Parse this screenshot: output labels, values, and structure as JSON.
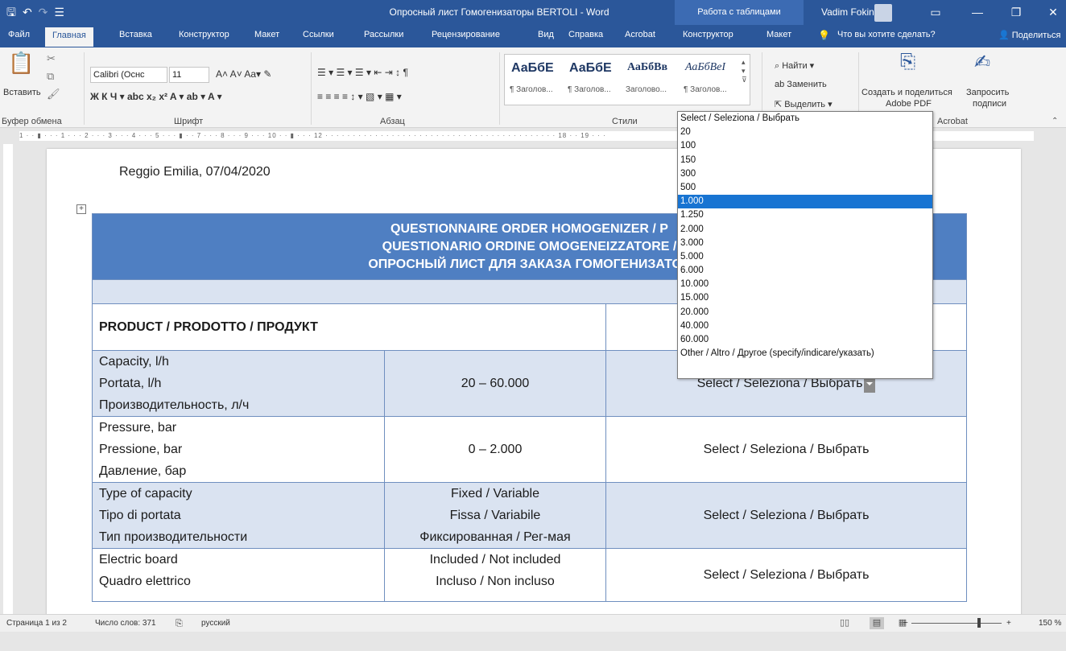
{
  "window": {
    "title": "Опросный лист Гомогенизаторы BERTOLI - Word",
    "context_label": "Работа с таблицами",
    "user": "Vadim Fokin"
  },
  "tabs": [
    "Файл",
    "Главная",
    "Вставка",
    "Конструктор",
    "Макет",
    "Ссылки",
    "Рассылки",
    "Рецензирование",
    "Вид",
    "Справка",
    "Acrobat",
    "Конструктор",
    "Макет"
  ],
  "tell_me": "Что вы хотите сделать?",
  "share": "Поделиться",
  "ribbon": {
    "paste": "Вставить",
    "clipboard": "Буфер обмена",
    "font_name": "Calibri (Оснс",
    "font_size": "11",
    "font_group": "Шрифт",
    "paragraph_group": "Абзац",
    "styles_group": "Стили",
    "style_sample_1": "АаБбЕ",
    "style_sample_2": "АаБбЕ",
    "style_sample_3": "АаБбВв",
    "style_sample_4": "АаБбВеI",
    "style_label_1": "¶ Заголов...",
    "style_label_2": "¶ Заголов...",
    "style_label_3": "Заголово...",
    "style_label_4": "¶ Заголов...",
    "find": "Найти",
    "replace": "Заменить",
    "select": "Выделить",
    "create_share": "Создать и поделиться",
    "adobe_pdf": "Adobe PDF",
    "request": "Запросить",
    "signatures": "подписи",
    "acrobat_group": "Acrobat"
  },
  "document": {
    "date_line": "Reggio Emilia, 07/04/2020",
    "header_1": "QUESTIONNAIRE ORDER HOMOGENIZER / P",
    "header_2": "QUESTIONARIO ORDINE OMOGENEIZZATORE /",
    "header_3": "ОПРОСНЫЙ ЛИСТ ДЛЯ ЗАКАЗА ГОМОГЕНИЗАТОР",
    "product": "PRODUCT / PRODOTTO / ПРОДУКТ",
    "rows": [
      {
        "l1": "Capacity, l/h",
        "l2": "Portata, l/h",
        "l3": "Производительность, л/ч",
        "range": "20 – 60.000",
        "select": "Select / Seleziona / Выбрать"
      },
      {
        "l1": "Pressure, bar",
        "l2": "Pressione, bar",
        "l3": "Давление, бар",
        "range": "0 – 2.000",
        "select": "Select / Seleziona / Выбрать"
      },
      {
        "l1": "Type of capacity",
        "l2": "Tipo di portata",
        "l3": "Тип производительности",
        "r1": "Fixed / Variable",
        "r2": "Fissa / Variabile",
        "r3": "Фиксированная / Рег-мая",
        "select": "Select / Seleziona / Выбрать"
      },
      {
        "l1": "Electric board",
        "l2": "Quadro elettrico",
        "r1": "Included / Not included",
        "r2": "Incluso / Non incluso",
        "select": "Select / Seleziona / Выбрать"
      }
    ]
  },
  "dropdown": {
    "options": [
      "Select / Seleziona / Выбрать",
      "20",
      "100",
      "150",
      "300",
      "500",
      "1.000",
      "1.250",
      "2.000",
      "3.000",
      "5.000",
      "6.000",
      "10.000",
      "15.000",
      "20.000",
      "40.000",
      "60.000",
      "Other / Altro / Другое (specify/indicare/указать)"
    ],
    "highlighted_index": 6,
    "highlight_color": "#1874d2"
  },
  "status": {
    "page": "Страница 1 из 2",
    "words": "Число слов: 371",
    "language": "русский",
    "zoom": "150 %"
  },
  "colors": {
    "title_bar": "#2b579a",
    "table_header": "#4f7fc2",
    "table_band": "#dae3f1"
  }
}
